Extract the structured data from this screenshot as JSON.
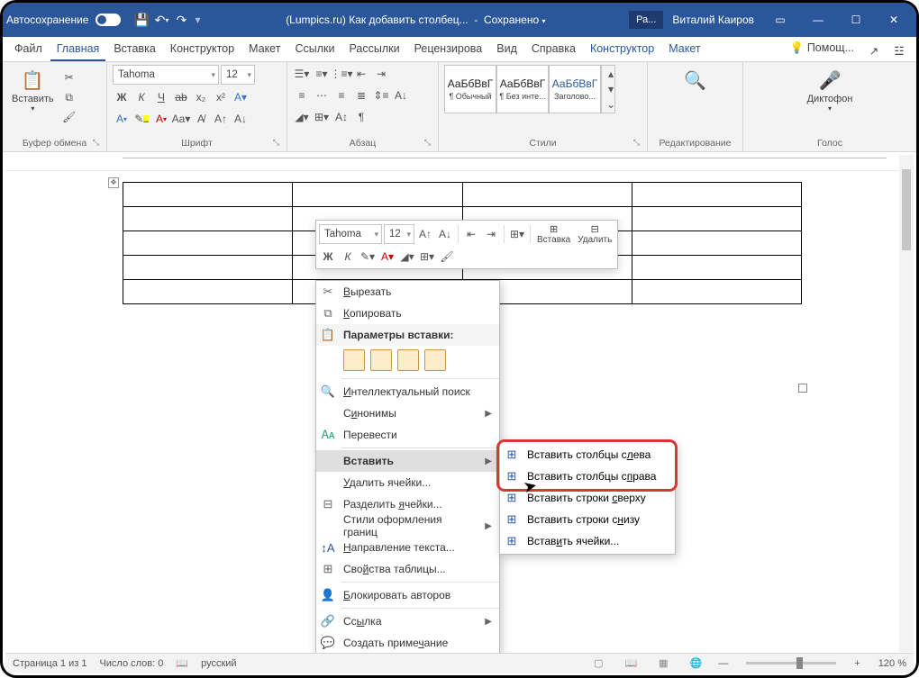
{
  "titlebar": {
    "autosave": "Автосохранение",
    "doc_title": "(Lumpics.ru) Как добавить столбец...",
    "saved_status": "Сохранено",
    "account_short": "Ра...",
    "user_name": "Виталий Каиров"
  },
  "tabs": {
    "file": "Файл",
    "home": "Главная",
    "insert": "Вставка",
    "design": "Конструктор",
    "layout": "Макет",
    "references": "Ссылки",
    "mailings": "Рассылки",
    "review": "Рецензирова",
    "view": "Вид",
    "help": "Справка",
    "tbl_design": "Конструктор",
    "tbl_layout": "Макет",
    "tell_me": "Помощ..."
  },
  "ribbon": {
    "clipboard": {
      "paste": "Вставить",
      "group": "Буфер обмена"
    },
    "font": {
      "name": "Tahoma",
      "size": "12",
      "group": "Шрифт",
      "bold": "Ж",
      "italic": "К",
      "underline": "Ч"
    },
    "paragraph": {
      "group": "Абзац"
    },
    "styles": {
      "group": "Стили",
      "sample": "АаБбВвГ",
      "normal": "¶ Обычный",
      "nospacing": "¶ Без инте...",
      "heading": "Заголово..."
    },
    "editing": {
      "group": "Редактирование"
    },
    "voice": {
      "label": "Диктофон",
      "group": "Голос"
    }
  },
  "mini": {
    "font": "Tahoma",
    "size": "12",
    "bold": "Ж",
    "italic": "К",
    "insert": "Вставка",
    "delete": "Удалить"
  },
  "context": {
    "cut": "Вырезать",
    "copy": "Копировать",
    "paste_options": "Параметры вставки:",
    "smart_lookup": "Интеллектуальный поиск",
    "synonyms": "Синонимы",
    "translate": "Перевести",
    "insert": "Вставить",
    "delete_cells": "Удалить ячейки...",
    "split_cells": "Разделить ячейки...",
    "border_styles": "Стили оформления границ",
    "text_direction": "Направление текста...",
    "table_properties": "Свойства таблицы...",
    "block_authors": "Блокировать авторов",
    "link": "Ссылка",
    "new_comment": "Создать примечание"
  },
  "submenu": {
    "cols_left": "Вставить столбцы слева",
    "cols_right": "Вставить столбцы справа",
    "rows_above": "Вставить строки сверху",
    "rows_below": "Вставить строки снизу",
    "cells": "Вставить ячейки..."
  },
  "status": {
    "page": "Страница 1 из 1",
    "words": "Число слов: 0",
    "lang": "русский",
    "zoom": "120 %"
  }
}
